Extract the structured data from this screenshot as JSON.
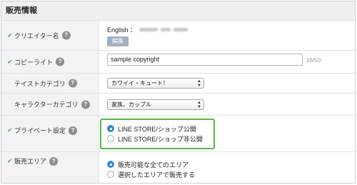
{
  "section": {
    "title": "販売情報"
  },
  "rows": {
    "creator": {
      "label": "クリエイター名",
      "lang_label": "English ：",
      "edit_label": "編集"
    },
    "copyright": {
      "label": "コピーライト",
      "value": "sample copyright",
      "counter": "16/50"
    },
    "taste": {
      "label": "テイストカテゴリ",
      "selected": "カワイイ・キュート！"
    },
    "character": {
      "label": "キャラクターカテゴリ",
      "selected": "家族、カップル"
    },
    "private": {
      "label": "プライベート設定",
      "options": [
        "LINE STORE/ショップ公開",
        "LINE STORE/ショップ非公開"
      ],
      "selected_index": 0
    },
    "area": {
      "label": "販売エリア",
      "options": [
        "販売可能な全てのエリア",
        "選択したエリアで販売する"
      ],
      "selected_index": 0
    }
  },
  "icons": {
    "check": "✔",
    "help": "?"
  },
  "colors": {
    "check": "#4caf50",
    "highlight": "#58b947",
    "radio_on": "#3b86d8",
    "edit_button": "#9fb0be"
  }
}
